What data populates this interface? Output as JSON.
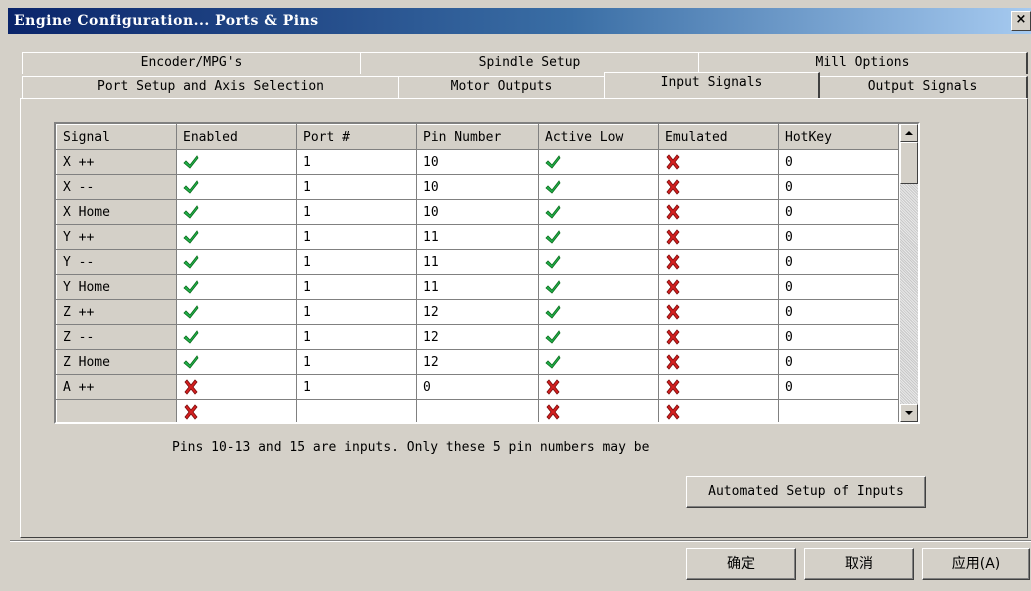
{
  "window": {
    "title": "Engine Configuration... Ports & Pins",
    "close_label": "×"
  },
  "tabs_back": [
    "Encoder/MPG's",
    "Spindle Setup",
    "Mill Options"
  ],
  "tabs_front": [
    "Port Setup and Axis Selection",
    "Motor Outputs",
    "Input Signals",
    "Output Signals"
  ],
  "active_tab": "Input Signals",
  "table": {
    "headers": [
      "Signal",
      "Enabled",
      "Port #",
      "Pin Number",
      "Active Low",
      "Emulated",
      "HotKey"
    ],
    "rows": [
      {
        "signal": "X ++",
        "enabled": true,
        "port": "1",
        "pin": "10",
        "active_low": true,
        "emulated": false,
        "hotkey": "0"
      },
      {
        "signal": "X --",
        "enabled": true,
        "port": "1",
        "pin": "10",
        "active_low": true,
        "emulated": false,
        "hotkey": "0"
      },
      {
        "signal": "X Home",
        "enabled": true,
        "port": "1",
        "pin": "10",
        "active_low": true,
        "emulated": false,
        "hotkey": "0"
      },
      {
        "signal": "Y ++",
        "enabled": true,
        "port": "1",
        "pin": "11",
        "active_low": true,
        "emulated": false,
        "hotkey": "0"
      },
      {
        "signal": "Y --",
        "enabled": true,
        "port": "1",
        "pin": "11",
        "active_low": true,
        "emulated": false,
        "hotkey": "0"
      },
      {
        "signal": "Y Home",
        "enabled": true,
        "port": "1",
        "pin": "11",
        "active_low": true,
        "emulated": false,
        "hotkey": "0"
      },
      {
        "signal": "Z ++",
        "enabled": true,
        "port": "1",
        "pin": "12",
        "active_low": true,
        "emulated": false,
        "hotkey": "0"
      },
      {
        "signal": "Z --",
        "enabled": true,
        "port": "1",
        "pin": "12",
        "active_low": true,
        "emulated": false,
        "hotkey": "0"
      },
      {
        "signal": "Z Home",
        "enabled": true,
        "port": "1",
        "pin": "12",
        "active_low": true,
        "emulated": false,
        "hotkey": "0"
      },
      {
        "signal": "A ++",
        "enabled": false,
        "port": "1",
        "pin": "0",
        "active_low": false,
        "emulated": false,
        "hotkey": "0"
      },
      {
        "signal": "",
        "enabled": false,
        "port": "",
        "pin": "",
        "active_low": false,
        "emulated": false,
        "hotkey": ""
      }
    ]
  },
  "note": "Pins 10-13 and 15 are inputs. Only these 5 pin numbers may be",
  "buttons": {
    "automated_setup": "Automated Setup of Inputs",
    "ok": "确定",
    "cancel": "取消",
    "apply": "应用(A)"
  },
  "icons": {
    "check": "green-checkmark-icon",
    "cross": "red-x-icon"
  },
  "colors": {
    "title_start": "#0a246a",
    "title_end": "#a6caf0",
    "check": "#22b14c",
    "cross": "#d42020",
    "face": "#d4d0c8"
  }
}
